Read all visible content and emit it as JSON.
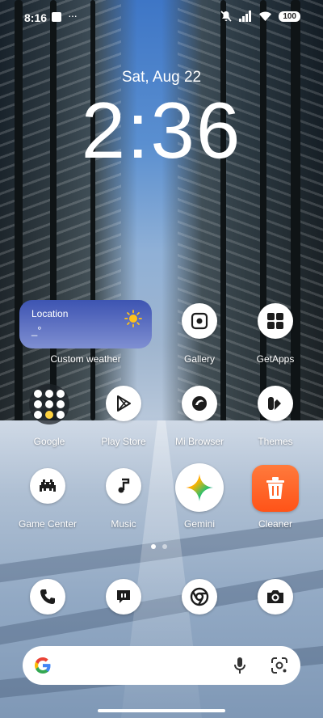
{
  "status_bar": {
    "time": "8:16",
    "battery": "100"
  },
  "lockclock": {
    "date": "Sat, Aug 22",
    "time": "2:36"
  },
  "weather_widget": {
    "location": "Location",
    "temp": "_°",
    "label": "Custom weather"
  },
  "apps": {
    "gallery": "Gallery",
    "getapps": "GetApps",
    "google": "Google",
    "play_store": "Play Store",
    "mi_browser": "Mi Browser",
    "themes": "Themes",
    "game_center": "Game Center",
    "music": "Music",
    "gemini": "Gemini",
    "cleaner": "Cleaner"
  },
  "pager": {
    "pages": 2,
    "current": 1
  },
  "dock": [
    "phone-icon",
    "messages-icon",
    "chrome-icon",
    "camera-icon"
  ],
  "search_bar": {
    "icons": [
      "google-g-icon",
      "mic-icon",
      "lens-icon"
    ]
  }
}
